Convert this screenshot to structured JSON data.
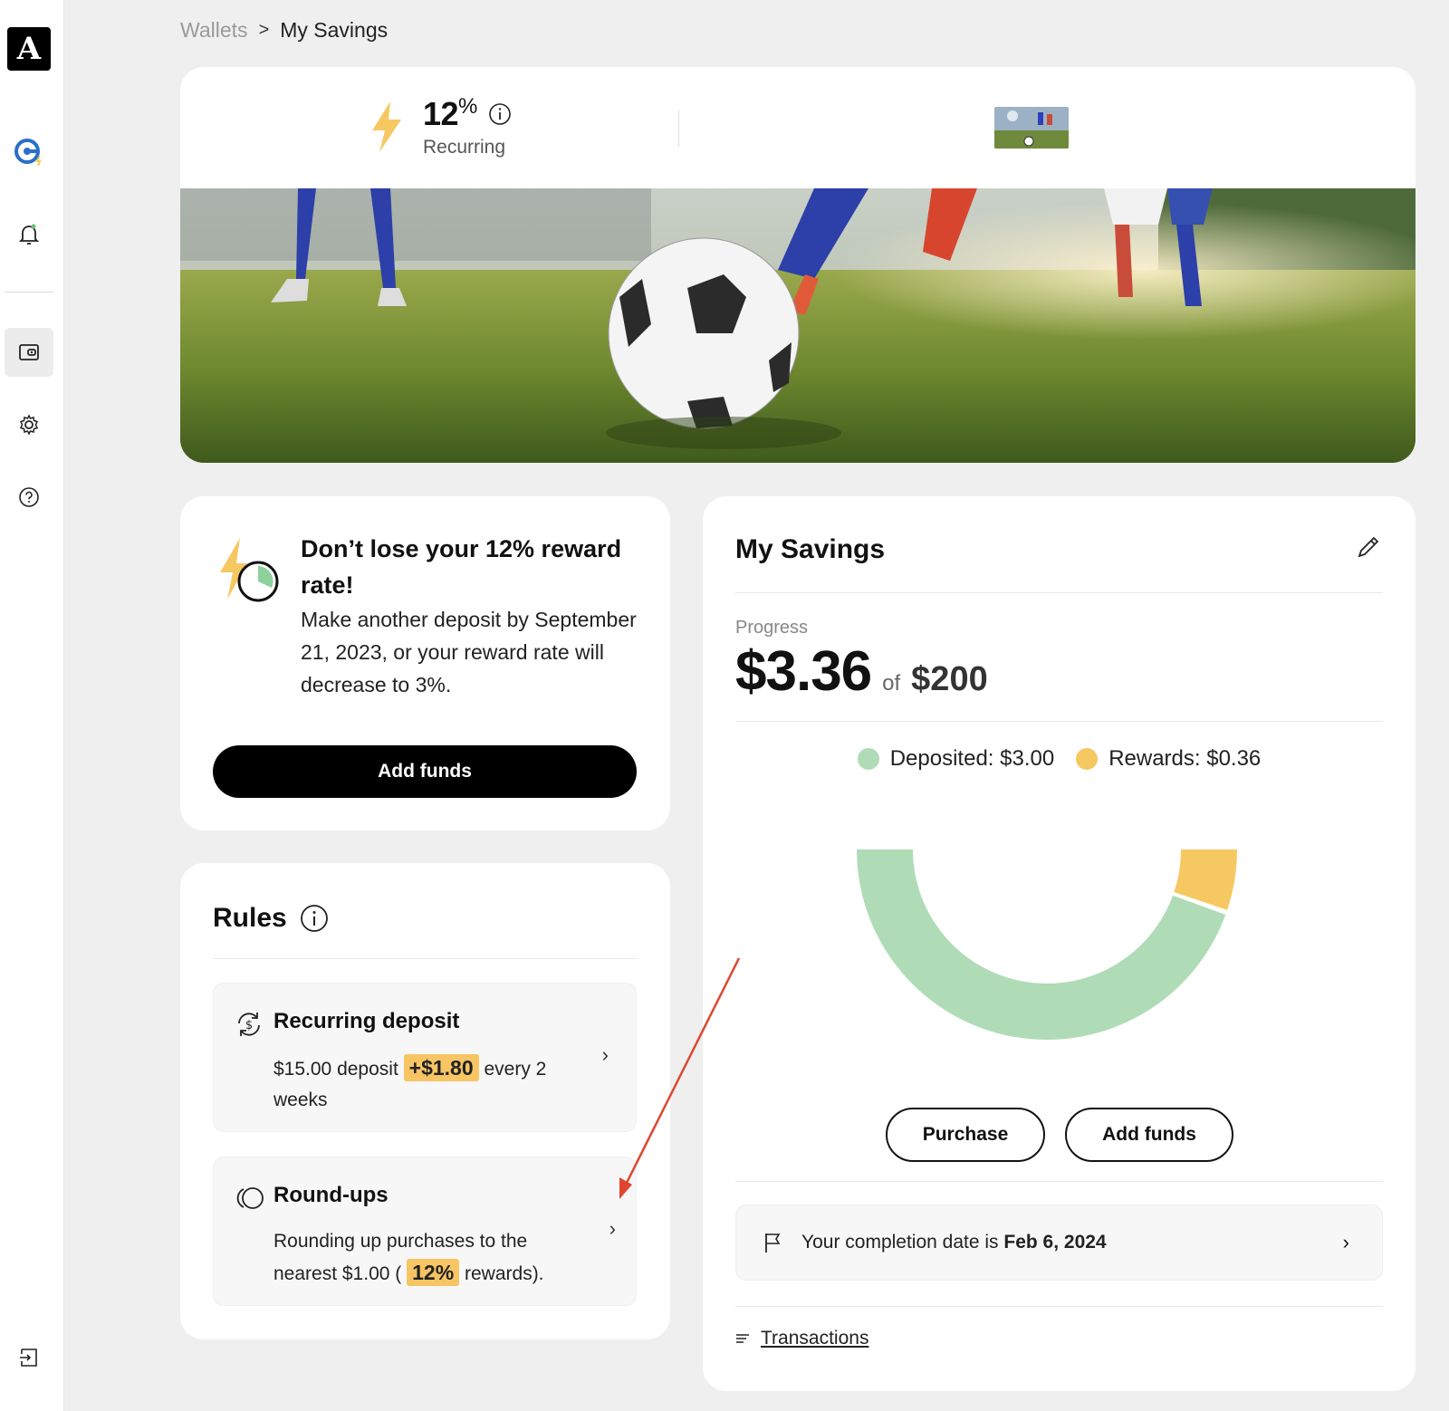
{
  "app": {
    "logo_letter": "A"
  },
  "sidebar": {
    "items": [
      {
        "name": "rewards-icon"
      },
      {
        "name": "bell-icon"
      },
      {
        "name": "wallet-icon",
        "active": true
      },
      {
        "name": "gear-icon"
      },
      {
        "name": "help-icon"
      },
      {
        "name": "logout-icon"
      }
    ]
  },
  "breadcrumb": {
    "parent": "Wallets",
    "separator": ">",
    "current": "My Savings"
  },
  "hero": {
    "rate": "12",
    "rate_suffix": "%",
    "rate_label": "Recurring"
  },
  "warning": {
    "title": "Don’t lose your 12% reward rate!",
    "body": "Make another deposit by September 21, 2023, or your reward rate will decrease to 3%.",
    "button": "Add funds"
  },
  "rules": {
    "title": "Rules",
    "items": [
      {
        "title": "Recurring deposit",
        "pre": "$15.00 deposit",
        "highlight": "+$1.80",
        "post": "every 2 weeks"
      },
      {
        "title": "Round-ups",
        "pre": "Rounding up purchases to the nearest $1.00 (",
        "highlight": "12%",
        "post": "rewards)."
      }
    ]
  },
  "savings": {
    "title": "My Savings",
    "progress_label": "Progress",
    "amount": "$3.36",
    "of": "of",
    "goal": "$200",
    "legend": [
      {
        "label": "Deposited: $3.00",
        "color": "#afdcb6"
      },
      {
        "label": "Rewards: $0.36",
        "color": "#f6c862"
      }
    ],
    "gauge": {
      "deposited": 3.0,
      "rewards": 0.36
    },
    "buttons": {
      "purchase": "Purchase",
      "add_funds": "Add funds"
    },
    "completion_prefix": "Your completion date is",
    "completion_date": "Feb 6, 2024",
    "transactions": "Transactions"
  },
  "colors": {
    "accent_yellow": "#f6c862",
    "deposit_green": "#afdcb6",
    "annotation_red": "#e0452f"
  }
}
